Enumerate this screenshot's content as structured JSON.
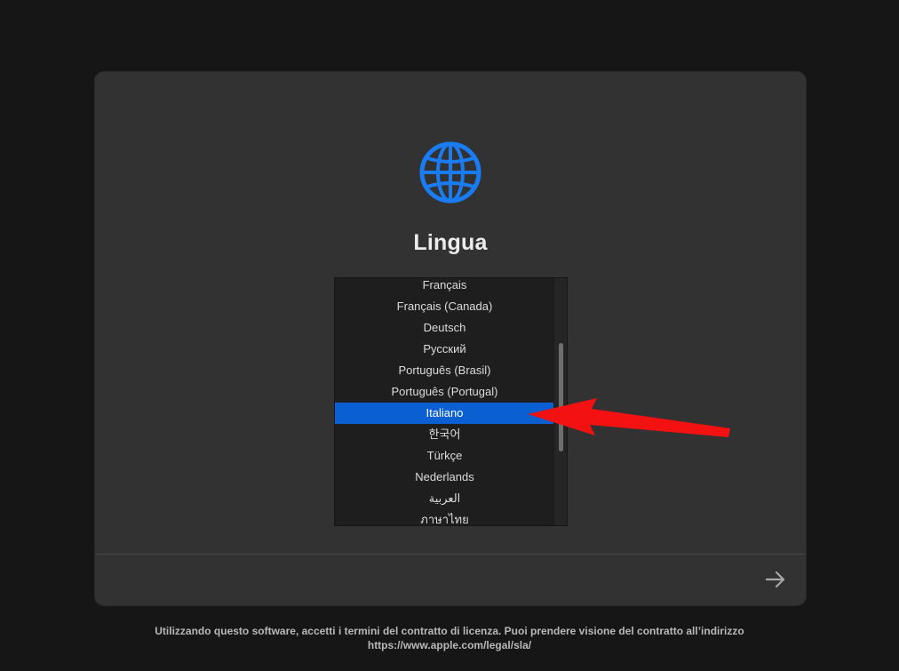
{
  "window": {
    "title": "Lingua"
  },
  "icons": {
    "globe": "globe-icon",
    "next": "arrow-right-icon"
  },
  "colors": {
    "accent": "#0a5fd3",
    "globe": "#1a7cf5",
    "annotation": "#f41111"
  },
  "language_list": {
    "items": [
      "Français",
      "Français (Canada)",
      "Deutsch",
      "Русский",
      "Português (Brasil)",
      "Português (Portugal)",
      "Italiano",
      "한국어",
      "Türkçe",
      "Nederlands",
      "العربية",
      "ภาษาไทย"
    ],
    "selected": "Italiano"
  },
  "footer": {
    "line1": "Utilizzando questo software, accetti i termini del contratto di licenza. Puoi prendere visione del contratto all’indirizzo",
    "line2": "https://www.apple.com/legal/sla/"
  }
}
